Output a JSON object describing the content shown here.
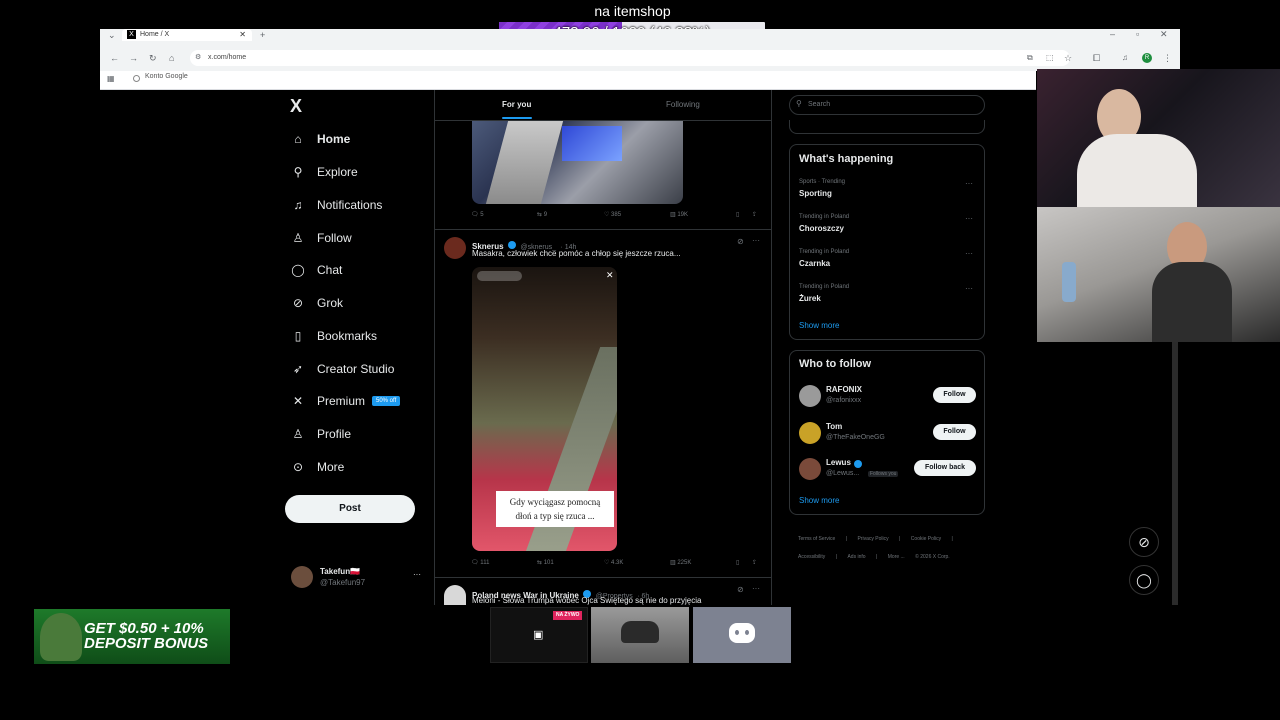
{
  "overlay": {
    "title": "na itemshop",
    "goal_text": "473.06 / 1020 (46.38%)",
    "goal_fraction": 0.4638
  },
  "browser": {
    "tab_title": "Home / X",
    "url": "x.com/home",
    "bookmark": "Konto Google",
    "profile_initial": "R"
  },
  "nav": {
    "logo": "X",
    "items": [
      {
        "label": "Home",
        "icon": "home-icon"
      },
      {
        "label": "Explore",
        "icon": "search-icon"
      },
      {
        "label": "Notifications",
        "icon": "bell-icon"
      },
      {
        "label": "Follow",
        "icon": "add-person-icon"
      },
      {
        "label": "Chat",
        "icon": "chat-icon"
      },
      {
        "label": "Grok",
        "icon": "grok-icon"
      },
      {
        "label": "Bookmarks",
        "icon": "bookmark-icon"
      },
      {
        "label": "Creator Studio",
        "icon": "rocket-icon"
      },
      {
        "label": "Premium",
        "icon": "x-icon"
      },
      {
        "label": "Profile",
        "icon": "person-icon"
      },
      {
        "label": "More",
        "icon": "more-circle-icon"
      }
    ],
    "premium_badge": "50% off",
    "post_label": "Post",
    "account": {
      "name": "Takefun🇵🇱",
      "handle": "@Takefun97",
      "more": "···"
    }
  },
  "timeline": {
    "tabs": {
      "for_you": "For you",
      "following": "Following"
    },
    "tweet1_actions": {
      "replies": "5",
      "reposts": "9",
      "likes": "385",
      "views": "19K"
    },
    "tweet2": {
      "name": "Sknerus",
      "handle": "@sknerus_",
      "time": "· 14h",
      "text": "Masakra, człowiek chce pomóc a chłop się jeszcze rzuca...",
      "video_caption": "Gdy wyciągasz pomocną dłoń a typ się rzuca ...",
      "replies": "111",
      "reposts": "101",
      "likes": "4.3K",
      "views": "225K"
    },
    "tweet3": {
      "name": "Poland news War in Ukraine",
      "handle": "@Propertys",
      "time": "· 6h",
      "text": "Meloni - Słowa Trumpa wobec Ojca Świętego są nie do przyjęcia"
    }
  },
  "right": {
    "search_placeholder": "Search",
    "whats_happening": "What's happening",
    "trends": [
      {
        "meta": "Sports · Trending",
        "name": "Sporting"
      },
      {
        "meta": "Trending in Poland",
        "name": "Choroszczy"
      },
      {
        "meta": "Trending in Poland",
        "name": "Czarnka"
      },
      {
        "meta": "Trending in Poland",
        "name": "Żurek"
      }
    ],
    "trends_show_more": "Show more",
    "who_to_follow": "Who to follow",
    "follow_suggestions": [
      {
        "name": "RAFONIX",
        "handle": "@rafonixxx",
        "button": "Follow"
      },
      {
        "name": "Tom",
        "handle": "@TheFakeOneGG",
        "button": "Follow"
      },
      {
        "name": "Lewus",
        "handle": "@Lewus...",
        "follows_you": "Follows you",
        "button": "Follow back"
      }
    ],
    "wtf_show_more": "Show more",
    "footer": [
      "Terms of Service",
      "|",
      "Privacy Policy",
      "|",
      "Cookie Policy",
      "|",
      "Accessibility",
      "|",
      "Ads info",
      "|",
      "More ...",
      "© 2026 X Corp."
    ]
  },
  "promo": {
    "text_line1": "GET $0.50 + 10%",
    "text_line2": "DEPOSIT BONUS"
  },
  "taskbar": {
    "live_badge": "NA ŻYWO"
  }
}
